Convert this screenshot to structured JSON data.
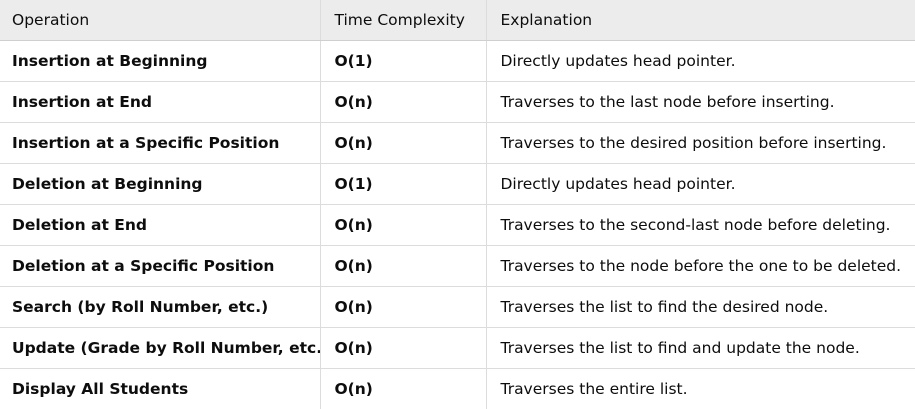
{
  "table": {
    "headers": [
      "Operation",
      "Time Complexity",
      "Explanation"
    ],
    "rows": [
      {
        "operation": "Insertion at Beginning",
        "complexity": "O(1)",
        "explanation": "Directly updates head pointer."
      },
      {
        "operation": "Insertion at End",
        "complexity": "O(n)",
        "explanation": "Traverses to the last node before inserting."
      },
      {
        "operation": "Insertion at a Specific Position",
        "complexity": "O(n)",
        "explanation": "Traverses to the desired position before inserting."
      },
      {
        "operation": "Deletion at Beginning",
        "complexity": "O(1)",
        "explanation": "Directly updates head pointer."
      },
      {
        "operation": "Deletion at End",
        "complexity": "O(n)",
        "explanation": "Traverses to the second-last node before deleting."
      },
      {
        "operation": "Deletion at a Specific Position",
        "complexity": "O(n)",
        "explanation": "Traverses to the node before the one to be deleted."
      },
      {
        "operation": "Search (by Roll Number, etc.)",
        "complexity": "O(n)",
        "explanation": "Traverses the list to find the desired node."
      },
      {
        "operation": "Update (Grade by Roll Number, etc.)",
        "complexity": "O(n)",
        "explanation": "Traverses the list to find and update the node."
      },
      {
        "operation": "Display All Students",
        "complexity": "O(n)",
        "explanation": "Traverses the entire list."
      }
    ]
  },
  "colors": {
    "header_background": "#ececec",
    "border": "#dcdcdc",
    "text": "#0d0d0d"
  }
}
